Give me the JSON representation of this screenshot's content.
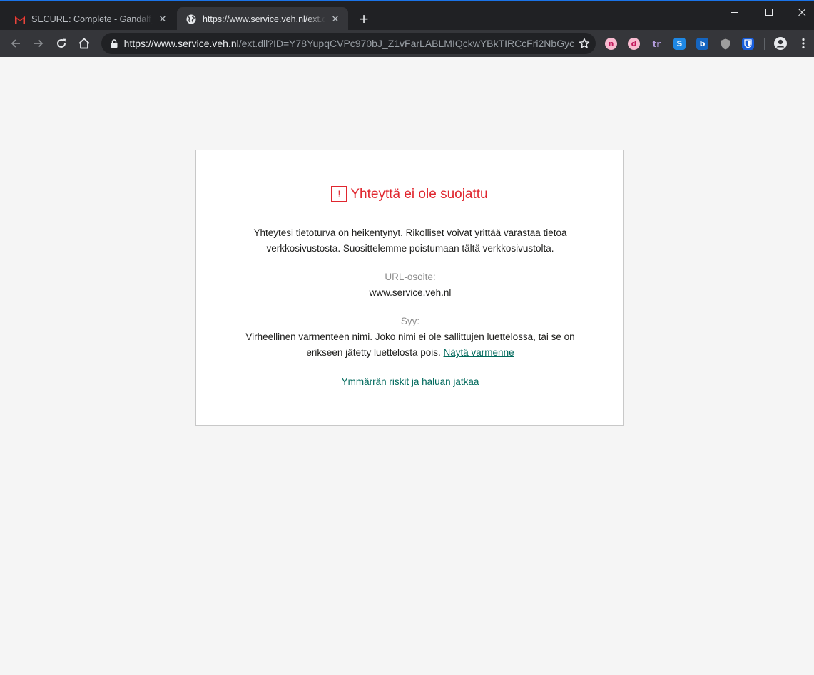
{
  "browser": {
    "tabs": [
      {
        "title": "SECURE: Complete - Gandalf_The",
        "active": false,
        "favicon": "gmail-icon"
      },
      {
        "title": "https://www.service.veh.nl/ext.dll",
        "active": true,
        "favicon": "globe-icon"
      }
    ],
    "new_tab_label": "+",
    "address": {
      "host_part": "https://www.service.veh.nl",
      "rest_part": "/ext.dll?ID=Y78YupqCVPc970bJ_Z1vFarLABLMIQckwYBkTIRCcFri2NbGyc..."
    },
    "extensions": [
      {
        "name": "n-extension-icon",
        "glyph": "n",
        "color": "#e4606d"
      },
      {
        "name": "d-extension-icon",
        "glyph": "d",
        "color": "#e4606d"
      },
      {
        "name": "tr-extension-icon",
        "glyph": "tr",
        "color": "#b39ddb"
      },
      {
        "name": "s-extension-icon",
        "glyph": "S",
        "color": "#1e88e5"
      },
      {
        "name": "b-extension-icon",
        "glyph": "b",
        "color": "#1565c0"
      },
      {
        "name": "shield-extension-icon",
        "glyph": "",
        "color": "#9e9e9e"
      },
      {
        "name": "bitwarden-icon",
        "glyph": "",
        "color": "#175ddc"
      }
    ]
  },
  "page": {
    "heading": "Yhteyttä ei ole suojattu",
    "warning_glyph": "!",
    "description_line1": "Yhteytesi tietoturva on heikentynyt. Rikolliset voivat yrittää varastaa tietoa",
    "description_line2": "verkkosivustosta. Suosittelemme poistumaan tältä verkkosivustolta.",
    "url_label": "URL-osoite:",
    "url_value": "www.service.veh.nl",
    "reason_label": "Syy:",
    "reason_line1": "Virheellinen varmenteen nimi. Joko nimi ei ole sallittujen luettelossa, tai se on",
    "reason_line2": "erikseen jätetty luettelosta pois.",
    "show_cert_link": "Näytä varmenne",
    "continue_link": "Ymmärrän riskit ja haluan jatkaa"
  },
  "colors": {
    "warning_red": "#e0272f",
    "link_green": "#00695c",
    "tabstrip_bg": "#202124",
    "toolbar_bg": "#35363a"
  }
}
